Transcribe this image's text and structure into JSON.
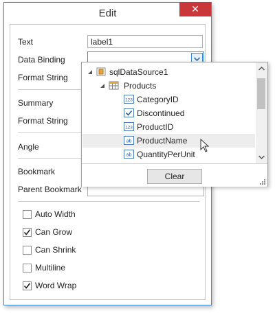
{
  "dialog": {
    "title": "Edit",
    "close_glyph": "✕"
  },
  "fields": {
    "text_label": "Text",
    "text_value": "label1",
    "data_binding_label": "Data Binding",
    "format_string_label_1": "Format String",
    "summary_label": "Summary",
    "format_string_label_2": "Format String",
    "angle_label": "Angle",
    "bookmark_label": "Bookmark",
    "parent_bookmark_label": "Parent Bookmark"
  },
  "checkboxes": [
    {
      "label": "Auto Width",
      "checked": false
    },
    {
      "label": "Can Grow",
      "checked": true
    },
    {
      "label": "Can Shrink",
      "checked": false
    },
    {
      "label": "Multiline",
      "checked": false
    },
    {
      "label": "Word Wrap",
      "checked": true
    }
  ],
  "dropdown": {
    "tree": [
      {
        "label": "sqlDataSource1",
        "icon": "datasource-icon",
        "level": 0
      },
      {
        "label": "Products",
        "icon": "table-icon",
        "level": 1
      },
      {
        "label": "CategoryID",
        "icon": "number-field-icon",
        "level": 2
      },
      {
        "label": "Discontinued",
        "icon": "boolean-field-icon",
        "level": 2
      },
      {
        "label": "ProductID",
        "icon": "number-field-icon",
        "level": 2
      },
      {
        "label": "ProductName",
        "icon": "string-field-icon",
        "level": 2,
        "hovered": true
      },
      {
        "label": "QuantityPerUnit",
        "icon": "string-field-icon",
        "level": 2
      }
    ],
    "clear_label": "Clear"
  },
  "colors": {
    "accent": "#3c89d6",
    "close": "#c9373a"
  }
}
